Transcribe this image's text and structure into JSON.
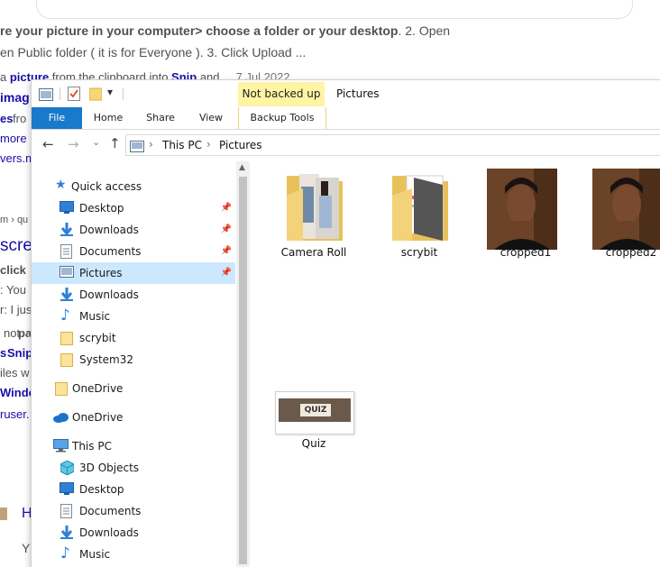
{
  "background": {
    "line1_bold": "re your picture in your computer> choose a folder or your desktop",
    "line1_rest": ". 2. Open",
    "line2": "en Public folder ( it is for Everyone ). 3. Click Upload ...",
    "line3_pre": "a ",
    "line3_b1": "picture",
    "line3_mid": " from the clipboard into ",
    "line3_b2": "Snip",
    "line3_and": " and ... ",
    "line3_date": "7 Jul 2022",
    "left_fragments": [
      "imag",
      "es",
      "fro",
      "more",
      "vers.m",
      "m › qu",
      "scre",
      "click",
      ": You",
      "r: I jus",
      "not",
      "pa",
      "s",
      "Snip",
      "iles w",
      "Windo",
      "ruser.",
      "H",
      "Y"
    ]
  },
  "titlebar": {
    "badge": "Not backed up",
    "title": "Pictures",
    "qat_dropdown": "▾"
  },
  "ribbon": {
    "tabs": [
      "File",
      "Home",
      "Share",
      "View",
      "Backup Tools"
    ]
  },
  "address": {
    "back": "←",
    "forward": "→",
    "recent": "⌄",
    "up": "↑",
    "crumbs": [
      "This PC",
      "Pictures"
    ],
    "sep": "›"
  },
  "nav": {
    "quick_access": "Quick access",
    "quick_items": [
      {
        "label": "Desktop",
        "icon": "desktop-icon",
        "pinned": true
      },
      {
        "label": "Downloads",
        "icon": "download-icon",
        "pinned": true
      },
      {
        "label": "Documents",
        "icon": "document-icon",
        "pinned": true
      },
      {
        "label": "Pictures",
        "icon": "pictures-icon",
        "pinned": true,
        "selected": true
      },
      {
        "label": "Downloads",
        "icon": "download-icon",
        "pinned": false
      },
      {
        "label": "Music",
        "icon": "music-icon",
        "pinned": false
      },
      {
        "label": "scrybit",
        "icon": "folder-icon",
        "pinned": false
      },
      {
        "label": "System32",
        "icon": "folder-icon",
        "pinned": false
      }
    ],
    "onedrive_personal": "OneDrive",
    "onedrive": "OneDrive",
    "this_pc": "This PC",
    "pc_items": [
      {
        "label": "3D Objects",
        "icon": "3d-objects-icon"
      },
      {
        "label": "Desktop",
        "icon": "desktop-icon"
      },
      {
        "label": "Documents",
        "icon": "document-icon"
      },
      {
        "label": "Downloads",
        "icon": "download-icon"
      },
      {
        "label": "Music",
        "icon": "music-icon"
      }
    ],
    "pin_glyph": "📌"
  },
  "files": [
    {
      "name": "Camera Roll",
      "type": "folder"
    },
    {
      "name": "scrybit",
      "type": "folder"
    },
    {
      "name": "cropped1",
      "type": "image"
    },
    {
      "name": "cropped2",
      "type": "image"
    },
    {
      "name": "Quiz",
      "type": "image",
      "thumb_text": "QUIZ"
    }
  ],
  "colors": {
    "accent": "#1979ca",
    "link": "#1a0dab",
    "badge_bg": "#fff4a3",
    "selected_bg": "#cce8ff"
  }
}
